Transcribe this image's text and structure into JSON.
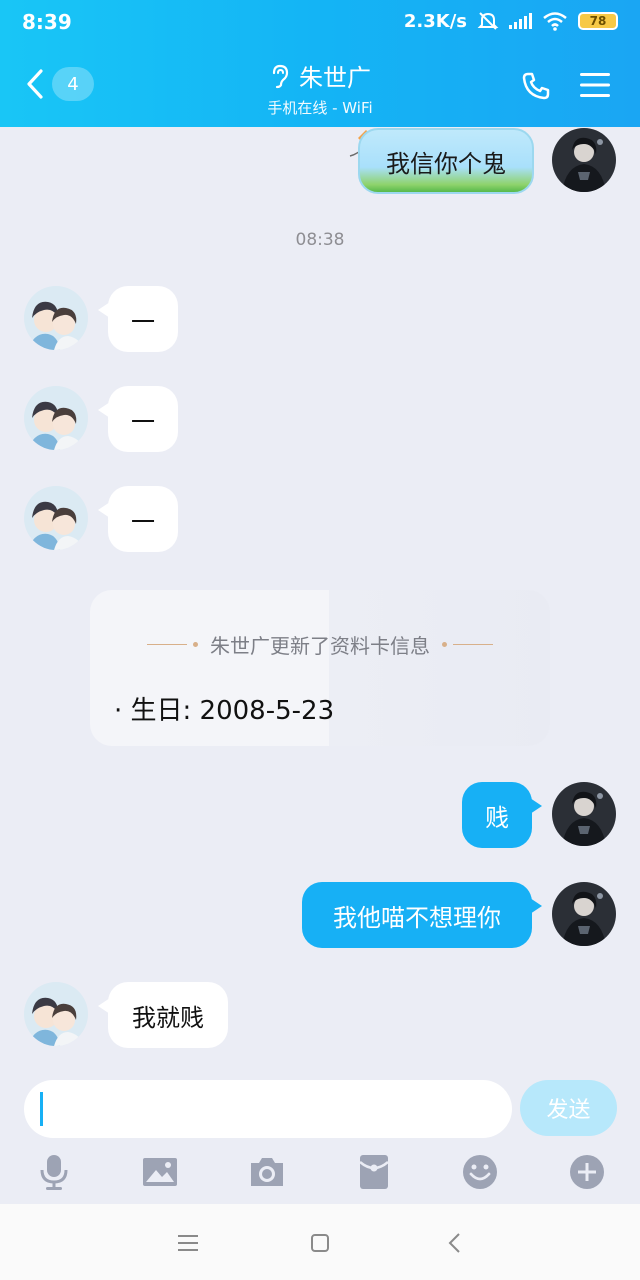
{
  "status_bar": {
    "time": "8:39",
    "speed": "2.3K/s",
    "battery": "78"
  },
  "header": {
    "back_count": "4",
    "title": "朱世广",
    "subtitle": "手机在线 - WiFi"
  },
  "messages": {
    "m1": "我信你个鬼",
    "divider_time": "08:38",
    "m2": "一",
    "m3": "一",
    "m4": "一",
    "m5": "贱",
    "m6": "我他喵不想理你",
    "m7": "我就贱"
  },
  "card": {
    "title": "朱世广更新了资料卡信息",
    "line": "· 生日: 2008-5-23"
  },
  "composer": {
    "send_label": "发送"
  },
  "colors": {
    "header": "#14b4f5",
    "bubble_self": "#17b0f5",
    "background": "#ebedf5"
  },
  "icons": {
    "toolbar": [
      "microphone-icon",
      "image-icon",
      "camera-icon",
      "red-packet-icon",
      "emoji-icon",
      "plus-icon"
    ],
    "nav": [
      "menu-nav-icon",
      "home-nav-icon",
      "back-nav-icon"
    ]
  }
}
